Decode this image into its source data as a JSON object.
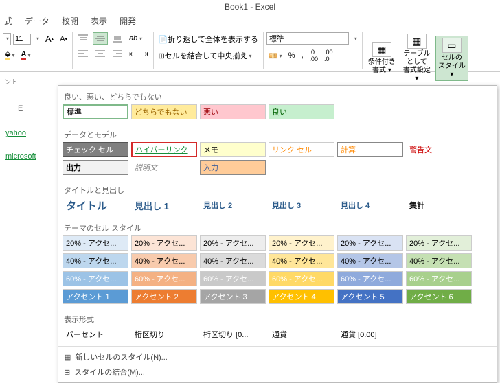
{
  "title": "Book1 - Excel",
  "tabs": [
    "式",
    "データ",
    "校閲",
    "表示",
    "開発"
  ],
  "font_size": "11",
  "wrap_label": "折り返して全体を表示する",
  "merge_label": "セルを結合して中央揃え",
  "number_format": "標準",
  "styles_group": {
    "cond": "条件付き\n書式 ▾",
    "table": "テーブルとして\n書式設定 ▾",
    "cell": "セルの\nスタイル ▾"
  },
  "left_label": "ント",
  "col_header": "E",
  "links": [
    "yahoo",
    "microsoft"
  ],
  "sections": {
    "s1": {
      "title": "良い、悪い、どちらでもない",
      "items": [
        {
          "t": "標準",
          "bg": "#ffffff",
          "fg": "#000",
          "bd": "#7fb98a",
          "bw": "2px"
        },
        {
          "t": "どちらでもない",
          "bg": "#ffeb9c",
          "fg": "#9c6500"
        },
        {
          "t": "悪い",
          "bg": "#ffc7ce",
          "fg": "#9c0006"
        },
        {
          "t": "良い",
          "bg": "#c6efce",
          "fg": "#006100"
        }
      ]
    },
    "s2": {
      "title": "データとモデル",
      "rows": [
        [
          {
            "t": "チェック セル",
            "bg": "#808080",
            "fg": "#fff",
            "bd": "#555"
          },
          {
            "t": "ハイパーリンク",
            "bg": "#fff",
            "fg": "#168f3a",
            "u": true,
            "bd": "#d42a2a",
            "bw": "2px"
          },
          {
            "t": "メモ",
            "bg": "#ffffcc",
            "fg": "#000"
          },
          {
            "t": "リンク セル",
            "bg": "#fff",
            "fg": "#ff8800"
          },
          {
            "t": "計算",
            "bg": "#fff",
            "fg": "#ff8800",
            "bd": "#888"
          },
          {
            "t": "警告文",
            "bg": "#fff",
            "fg": "#cc0000",
            "bd": "transparent"
          }
        ],
        [
          {
            "t": "出力",
            "bg": "#f2f2f2",
            "fg": "#000",
            "b": true,
            "bd": "#888"
          },
          {
            "t": "説明文",
            "bg": "#fff",
            "fg": "#888",
            "i": true,
            "bd": "transparent"
          },
          {
            "t": "入力",
            "bg": "#ffcc99",
            "fg": "#3f5f9a",
            "bd": "#888"
          }
        ]
      ]
    },
    "s3": {
      "title": "タイトルと見出し",
      "items": [
        {
          "t": "タイトル",
          "fg": "#2a5a8a",
          "fs": "15px",
          "b": true,
          "bd": "transparent"
        },
        {
          "t": "見出し 1",
          "fg": "#2a5a8a",
          "fs": "13px",
          "b": true,
          "bb": "2px solid #5b9bd5"
        },
        {
          "t": "見出し 2",
          "fg": "#2a5a8a",
          "b": true,
          "bb": "2px solid #a6c4e4"
        },
        {
          "t": "見出し 3",
          "fg": "#2a5a8a",
          "b": true,
          "bb": "1px solid #a6c4e4"
        },
        {
          "t": "見出し 4",
          "fg": "#2a5a8a",
          "b": true
        },
        {
          "t": "集計",
          "fg": "#000",
          "b": true,
          "bt": "1px solid #5b9bd5",
          "bb": "3px double #5b9bd5"
        }
      ]
    },
    "s4": {
      "title": "テーマのセル スタイル",
      "rows": [
        [
          {
            "t": "20% - アクセ...",
            "bg": "#deeaf6",
            "fg": "#000"
          },
          {
            "t": "20% - アクセ...",
            "bg": "#fce4d6",
            "fg": "#000"
          },
          {
            "t": "20% - アクセ...",
            "bg": "#ededed",
            "fg": "#000"
          },
          {
            "t": "20% - アクセ...",
            "bg": "#fff2cc",
            "fg": "#000"
          },
          {
            "t": "20% - アクセ...",
            "bg": "#d9e2f3",
            "fg": "#000"
          },
          {
            "t": "20% - アクセ...",
            "bg": "#e2efd9",
            "fg": "#000"
          }
        ],
        [
          {
            "t": "40% - アクセ...",
            "bg": "#bdd7ee",
            "fg": "#000"
          },
          {
            "t": "40% - アクセ...",
            "bg": "#f8cbad",
            "fg": "#000"
          },
          {
            "t": "40% - アクセ...",
            "bg": "#dbdbdb",
            "fg": "#000"
          },
          {
            "t": "40% - アクセ...",
            "bg": "#ffe699",
            "fg": "#000"
          },
          {
            "t": "40% - アクセ...",
            "bg": "#b4c6e7",
            "fg": "#000"
          },
          {
            "t": "40% - アクセ...",
            "bg": "#c5e0b3",
            "fg": "#000"
          }
        ],
        [
          {
            "t": "60% - アクセ...",
            "bg": "#9cc3e6",
            "fg": "#fff"
          },
          {
            "t": "60% - アクセ...",
            "bg": "#f4b183",
            "fg": "#fff"
          },
          {
            "t": "60% - アクセ...",
            "bg": "#c9c9c9",
            "fg": "#fff"
          },
          {
            "t": "60% - アクセ...",
            "bg": "#ffd966",
            "fg": "#fff"
          },
          {
            "t": "60% - アクセ...",
            "bg": "#8faadc",
            "fg": "#fff"
          },
          {
            "t": "60% - アクセ...",
            "bg": "#a8d08d",
            "fg": "#fff"
          }
        ],
        [
          {
            "t": "アクセント 1",
            "bg": "#5b9bd5",
            "fg": "#fff"
          },
          {
            "t": "アクセント 2",
            "bg": "#ed7d31",
            "fg": "#fff"
          },
          {
            "t": "アクセント 3",
            "bg": "#a5a5a5",
            "fg": "#fff"
          },
          {
            "t": "アクセント 4",
            "bg": "#ffc000",
            "fg": "#fff"
          },
          {
            "t": "アクセント 5",
            "bg": "#4472c4",
            "fg": "#fff"
          },
          {
            "t": "アクセント 6",
            "bg": "#70ad47",
            "fg": "#fff"
          }
        ]
      ]
    },
    "s5": {
      "title": "表示形式",
      "items": [
        {
          "t": "パーセント"
        },
        {
          "t": "桁区切り"
        },
        {
          "t": "桁区切り [0..."
        },
        {
          "t": "通貨"
        },
        {
          "t": "通貨 [0.00]"
        }
      ]
    }
  },
  "footer": {
    "new": "新しいセルのスタイル(N)...",
    "merge": "スタイルの結合(M)..."
  }
}
